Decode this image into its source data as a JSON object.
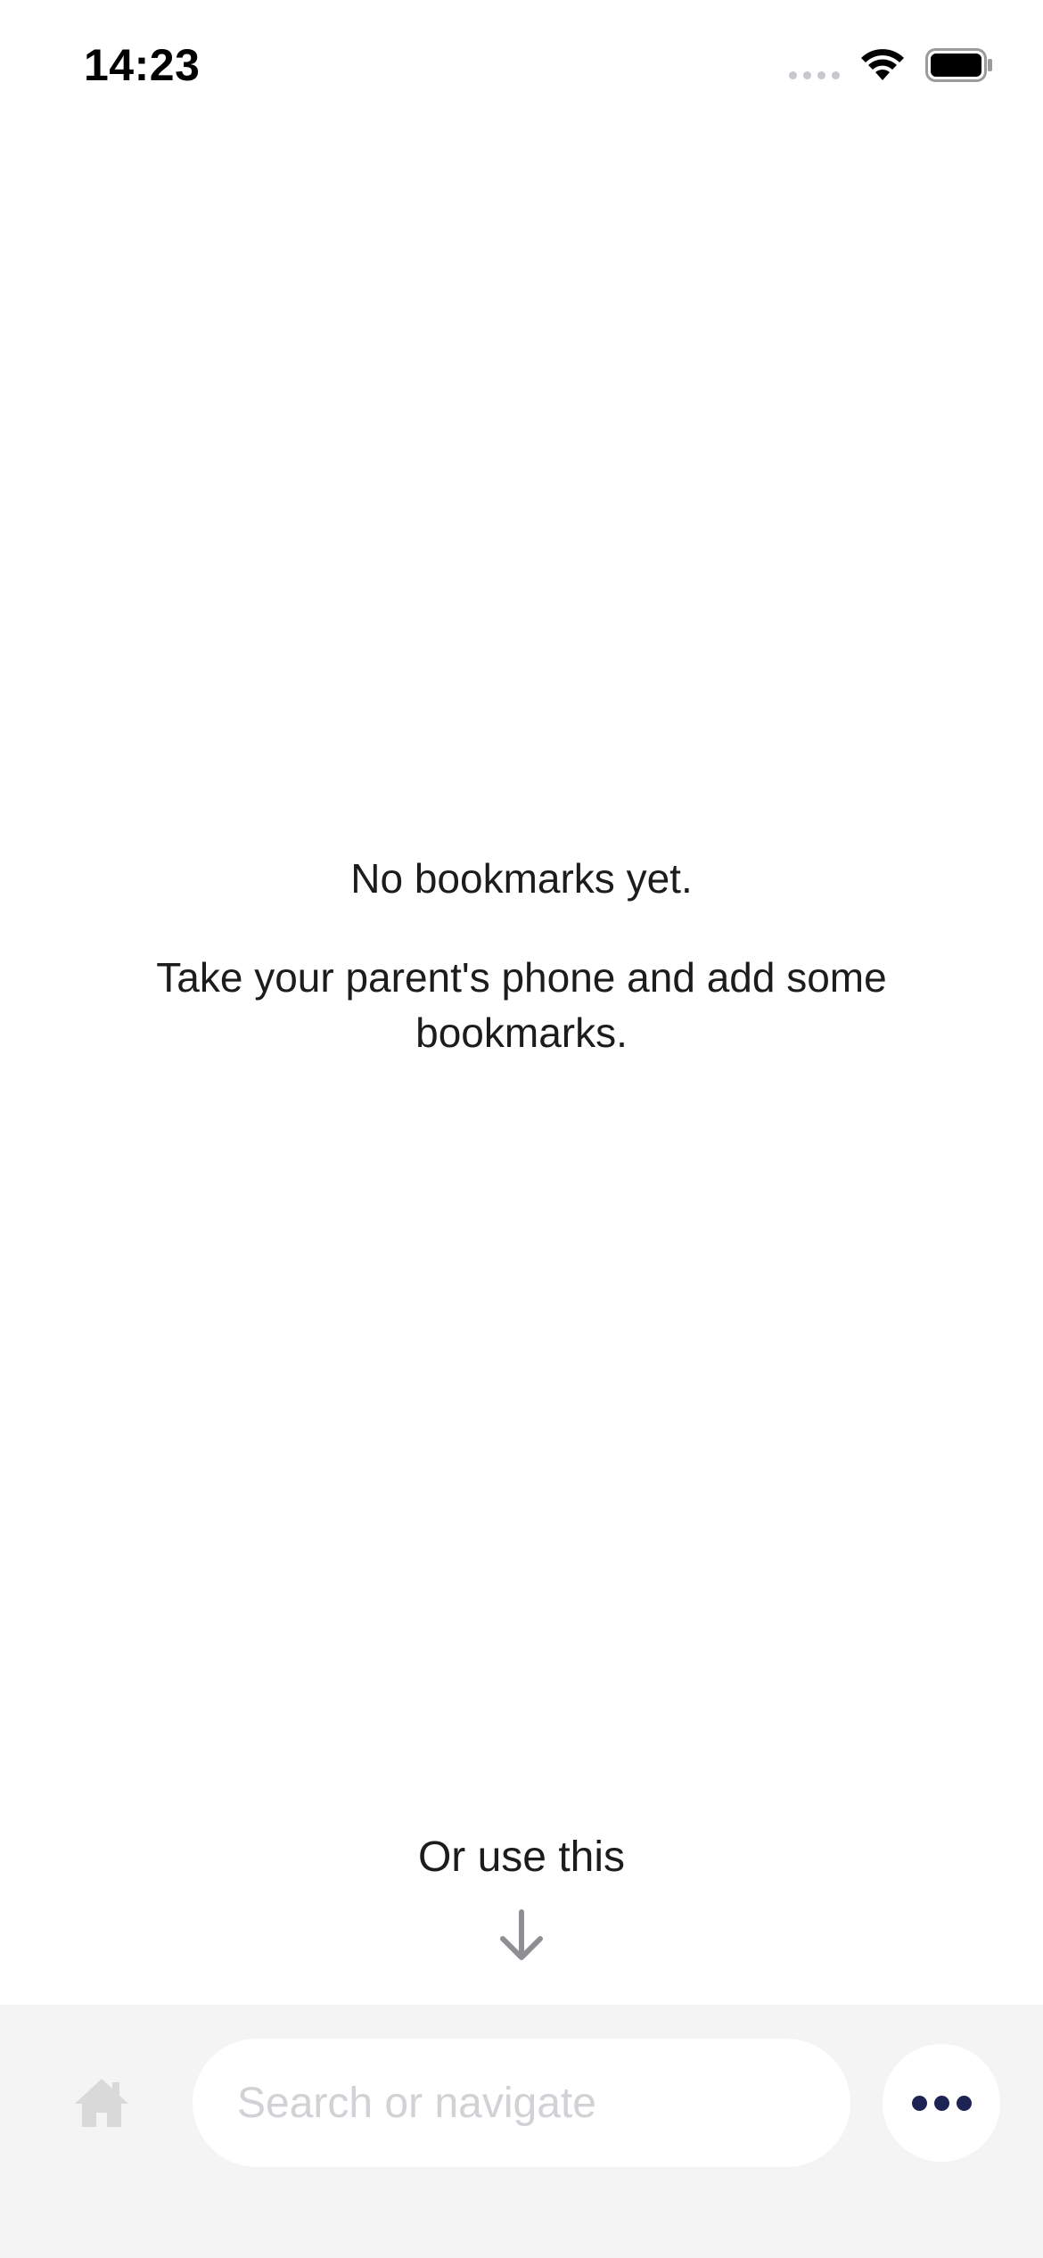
{
  "status_bar": {
    "time": "14:23",
    "icons": [
      "cellular-signal-icon",
      "wifi-icon",
      "battery-icon"
    ]
  },
  "empty_state": {
    "title": "No bookmarks yet.",
    "body": "Take your parent's phone and add some bookmarks."
  },
  "hint": {
    "text": "Or use this",
    "icon": "arrow-down-icon"
  },
  "toolbar": {
    "home_icon": "home-icon",
    "search_placeholder": "Search or navigate",
    "search_value": "",
    "more_icon": "more-dots-icon"
  },
  "colors": {
    "background": "#ffffff",
    "toolbar_background": "#f4f4f4",
    "accent": "#1d2352",
    "placeholder": "#d1d1d6",
    "muted_icon": "#d9d9d9"
  }
}
